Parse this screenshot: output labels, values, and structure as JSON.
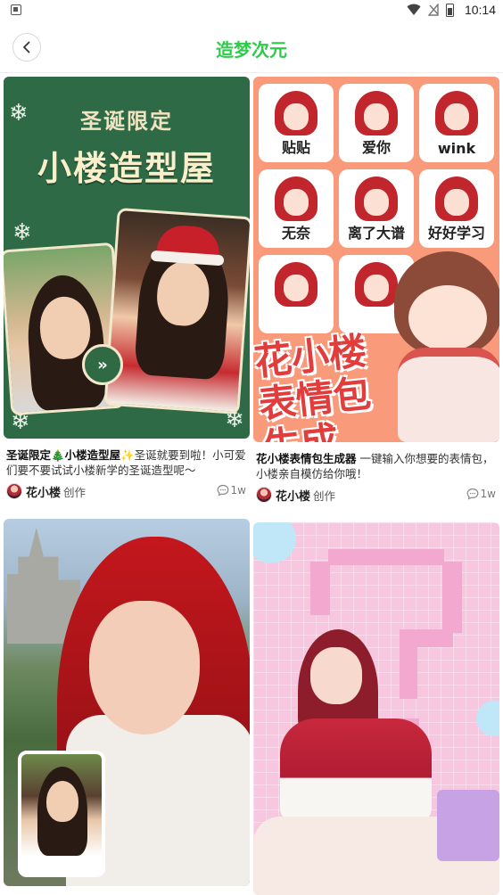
{
  "status_bar": {
    "time": "10:14",
    "notification_icon": "app-notification-icon",
    "icons": [
      "wifi-icon",
      "no-signal-icon",
      "battery-icon"
    ]
  },
  "header": {
    "title": "造梦次元",
    "back_icon": "chevron-left-icon"
  },
  "colors": {
    "title_green": "#2ccb4a",
    "xmas_green": "#2e6a45",
    "sticker_orange": "#f99a7b",
    "pixel_pink": "#f7c6df"
  },
  "cards": [
    {
      "image": {
        "sub_title": "圣诞限定",
        "main_title": "小楼造型屋"
      },
      "title": "圣诞限定🎄小楼造型屋✨",
      "text": "圣诞就要到啦！小可爱们要不要试试小楼新学的圣诞造型呢～",
      "author": "花小楼",
      "created": "创作",
      "comments": "1w"
    },
    {
      "image": {
        "captions": [
          "贴贴",
          "爱你",
          "wink",
          "无奈",
          "离了大谱",
          "好好学习"
        ],
        "overlay_title_1": "花小楼",
        "overlay_title_2": "表情包",
        "overlay_title_3": "生成"
      },
      "title": "花小楼表情包生成器",
      "text": " 一键输入你想要的表情包，小楼亲自模仿给你哦！",
      "author": "花小楼",
      "created": "创作",
      "comments": "1w"
    },
    {
      "image": {}
    },
    {
      "image": {}
    }
  ]
}
